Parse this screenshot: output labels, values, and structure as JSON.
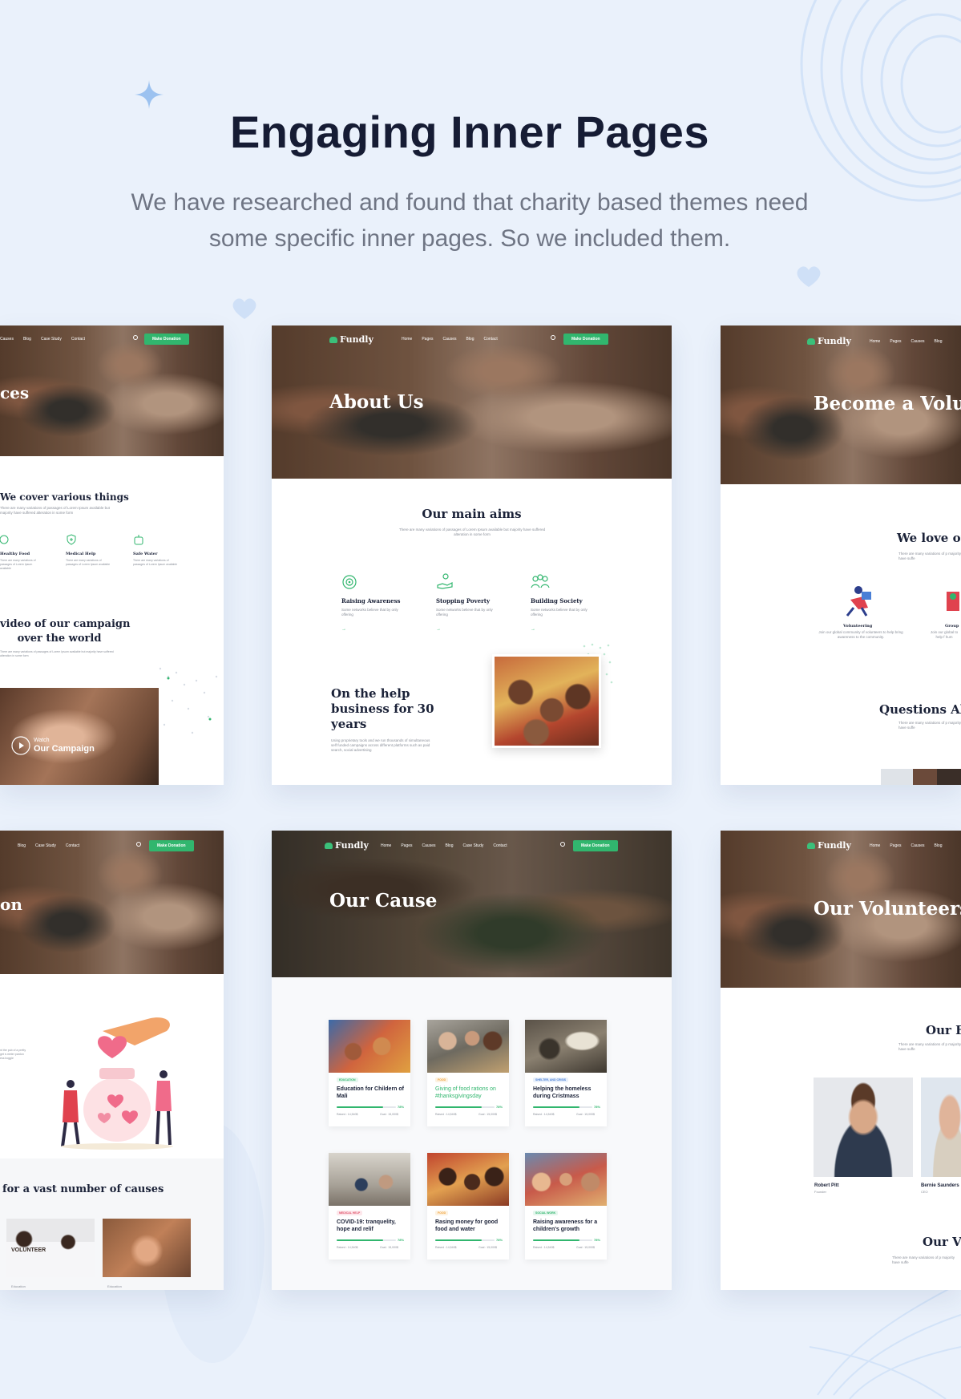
{
  "page": {
    "title": "Engaging Inner Pages",
    "subtitle_line1": "We have researched and found that charity based themes need",
    "subtitle_line2": "some specific inner pages. So we included them."
  },
  "colors": {
    "background": "#eaf1fb",
    "heading": "#161c34",
    "accent_green": "#31b66e",
    "deco_blue": "#cfe0f7"
  },
  "common": {
    "brand": "Fundly",
    "donate_label": "Make Donation",
    "nav": [
      "Home",
      "Pages",
      "Causes",
      "Blog",
      "Case Study",
      "Contact"
    ],
    "nav_short": [
      "Case Study",
      "Contact"
    ],
    "nav_short2": [
      "Causes",
      "Blog",
      "Case Study",
      "Contact"
    ]
  },
  "cards": {
    "services": {
      "hero_title": "ces",
      "section_title": "We cover various things",
      "section_text": "There are many variations of passages of Lorem Ipsum available but majority have suffered alteration in some form",
      "features": [
        {
          "title": "Healthy Food",
          "text": "There are many variations of passages of Lorem Ipsum available"
        },
        {
          "title": "Medical Help",
          "text": "There are many variations of passages of Lorem Ipsum available"
        },
        {
          "title": "Safe Water",
          "text": "There are many variations of passages of Lorem Ipsum available"
        }
      ],
      "video_title_line1": "video of our campaign",
      "video_title_line2": "over the world",
      "video_text": "There are many variations of passages of Lorem Ipsum available but majority have suffered alteration in some form",
      "watch_label": "Watch",
      "campaign_label": "Our Campaign"
    },
    "about": {
      "hero_title": "About Us",
      "nav": [
        "Home",
        "Pages",
        "Causes",
        "Blog",
        "Contact"
      ],
      "section_title": "Our main aims",
      "section_text": "There are many variations of passages of Lorem Ipsum available but majority have suffered alteration in some form",
      "features": [
        {
          "title": "Raising Awareness",
          "text": "Some networks believe that by only offering"
        },
        {
          "title": "Stopping Poverty",
          "text": "Some networks believe that by only offering"
        },
        {
          "title": "Building Society",
          "text": "Some networks believe that by only offering"
        }
      ],
      "help_title_line1": "On the help",
      "help_title_line2": "business for 30",
      "help_title_line3": "years",
      "help_text": "Using proprietary tools and we run thousands of simultaneous self funded campaigns across different platforms such as paid search, social advertising"
    },
    "volunteer": {
      "hero_title": "Become a Volun",
      "nav": [
        "Home",
        "Pages",
        "Causes",
        "Blog"
      ],
      "section_title": "We love ou",
      "section_text": "There are many variations of p majority have suffe",
      "features": [
        {
          "title": "Volunteering",
          "text": "Join our global community of volunteers to help bring awareness to the community."
        },
        {
          "title": "Group",
          "text": "Join our global to help f hum"
        }
      ],
      "faq_title": "Questions Ab",
      "faq_text": "There are many variations of p majority have suffe"
    },
    "donation": {
      "hero_title": "on",
      "cause_title": "for a vast number of causes",
      "side_text": "nt the pub of a pretty get e-meter pardon ess boggle",
      "cause_tags": [
        "Education",
        "Education"
      ],
      "volunteer_shirt": "VOLUNTEER"
    },
    "causes": {
      "hero_title": "Our Cause",
      "items": [
        {
          "tag": "EDUCATION",
          "tag_color": "#31b66e",
          "title": "Education for Childern of Mali",
          "title_color": "#1b2238",
          "progress": 0.78,
          "pct": "78%",
          "raised": "Raised : 14,540$",
          "goal": "Goal : 15,000$"
        },
        {
          "tag": "FOOD",
          "tag_color": "#f0a23b",
          "title": "Giving of food rations on #thanksgivingsday",
          "title_color": "#31b66e",
          "progress": 0.78,
          "pct": "78%",
          "raised": "Raised : 14,540$",
          "goal": "Goal : 15,000$"
        },
        {
          "tag": "SHELTER, AND CRISIS",
          "tag_color": "#4a7fd6",
          "title": "Helping the homeless during Cristmass",
          "title_color": "#1b2238",
          "progress": 0.78,
          "pct": "78%",
          "raised": "Raised : 14,540$",
          "goal": "Goal : 15,000$"
        },
        {
          "tag": "MEDICAL HELP",
          "tag_color": "#e0566d",
          "title": "COVID-19: tranquelity, hope and relif",
          "title_color": "#1b2238",
          "progress": 0.78,
          "pct": "78%",
          "raised": "Raised : 14,540$",
          "goal": "Goal : 15,000$"
        },
        {
          "tag": "FOOD",
          "tag_color": "#f0a23b",
          "title": "Rasing money for good food and water",
          "title_color": "#1b2238",
          "progress": 0.78,
          "pct": "78%",
          "raised": "Raised : 14,540$",
          "goal": "Goal : 15,000$"
        },
        {
          "tag": "SOCIAL WORK",
          "tag_color": "#31b66e",
          "title": "Raising awareness for a children's growth",
          "title_color": "#1b2238",
          "progress": 0.78,
          "pct": "78%",
          "raised": "Raised : 14,540$",
          "goal": "Goal : 15,000$"
        }
      ]
    },
    "volunteers": {
      "hero_title": "Our Volunteers",
      "nav": [
        "Home",
        "Pages",
        "Causes",
        "Blog"
      ],
      "section_title": "Our F",
      "section_text": "There are many variations of p majority have suffe",
      "people": [
        {
          "name": "Robert Pitt",
          "role": "Founder"
        },
        {
          "name": "Bernie Saunders",
          "role": "CEO"
        }
      ],
      "bottom_title": "Our Vo",
      "bottom_text": "There are many variations of p majority have suffe"
    }
  }
}
